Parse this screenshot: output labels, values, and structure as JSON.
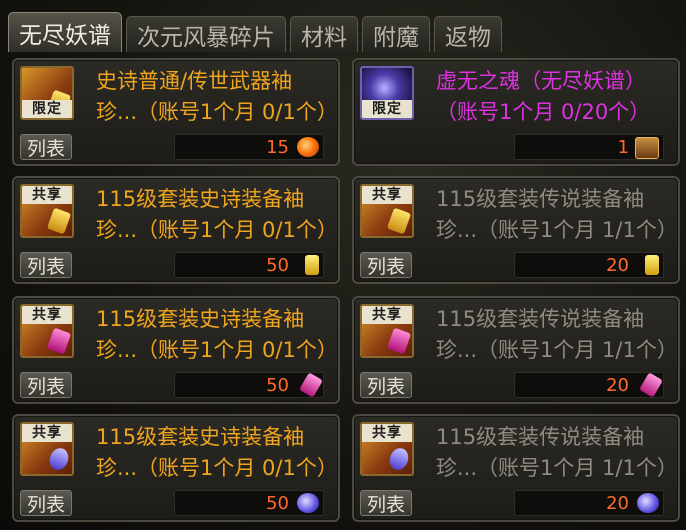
{
  "tabs": [
    {
      "label": "无尽妖谱",
      "active": true
    },
    {
      "label": "次元风暴碎片",
      "active": false
    },
    {
      "label": "材料",
      "active": false
    },
    {
      "label": "附魔",
      "active": false
    },
    {
      "label": "返物",
      "active": false
    }
  ],
  "list_button_label": "列表",
  "items": [
    {
      "badge": "限定",
      "icon": "weapon-chest-icon",
      "line1": "史诗普通/传世武器袖",
      "line2": "珍...（账号1个月 0/1个）",
      "price": "15",
      "currency_icon": "fire-orb-icon",
      "title_color": "#f0a51e"
    },
    {
      "badge": "限定",
      "icon": "void-soul-icon",
      "line1": "虚无之魂（无尽妖谱）",
      "line2": "（账号1个月 0/20个）",
      "price": "1",
      "currency_icon": "chest-icon",
      "title_color": "#dd32e0"
    },
    {
      "badge": "共享",
      "icon": "epic-box-gold-icon",
      "line1": "115级套装史诗装备袖",
      "line2": "珍...（账号1个月 0/1个）",
      "price": "50",
      "currency_icon": "gold-bar-icon",
      "title_color": "#f0a51e"
    },
    {
      "badge": "共享",
      "icon": "legend-box-gold-icon",
      "line1": "115级套装传说装备袖",
      "line2": "珍...（账号1个月 1/1个）",
      "price": "20",
      "currency_icon": "gold-bar-icon",
      "title_color": "#8f8b80"
    },
    {
      "badge": "共享",
      "icon": "epic-box-ruby-icon",
      "line1": "115级套装史诗装备袖",
      "line2": "珍...（账号1个月 0/1个）",
      "price": "50",
      "currency_icon": "ruby-crystal-icon",
      "title_color": "#f0a51e"
    },
    {
      "badge": "共享",
      "icon": "legend-box-ruby-icon",
      "line1": "115级套装传说装备袖",
      "line2": "珍...（账号1个月 1/1个）",
      "price": "20",
      "currency_icon": "ruby-crystal-icon",
      "title_color": "#8f8b80"
    },
    {
      "badge": "共享",
      "icon": "epic-box-sapphire-icon",
      "line1": "115级套装史诗装备袖",
      "line2": "珍...（账号1个月 0/1个）",
      "price": "50",
      "currency_icon": "sapphire-icon",
      "title_color": "#f0a51e"
    },
    {
      "badge": "共享",
      "icon": "legend-box-sapphire-icon",
      "line1": "115级套装传说装备袖",
      "line2": "珍...（账号1个月 1/1个）",
      "price": "20",
      "currency_icon": "sapphire-icon",
      "title_color": "#8f8b80"
    }
  ]
}
